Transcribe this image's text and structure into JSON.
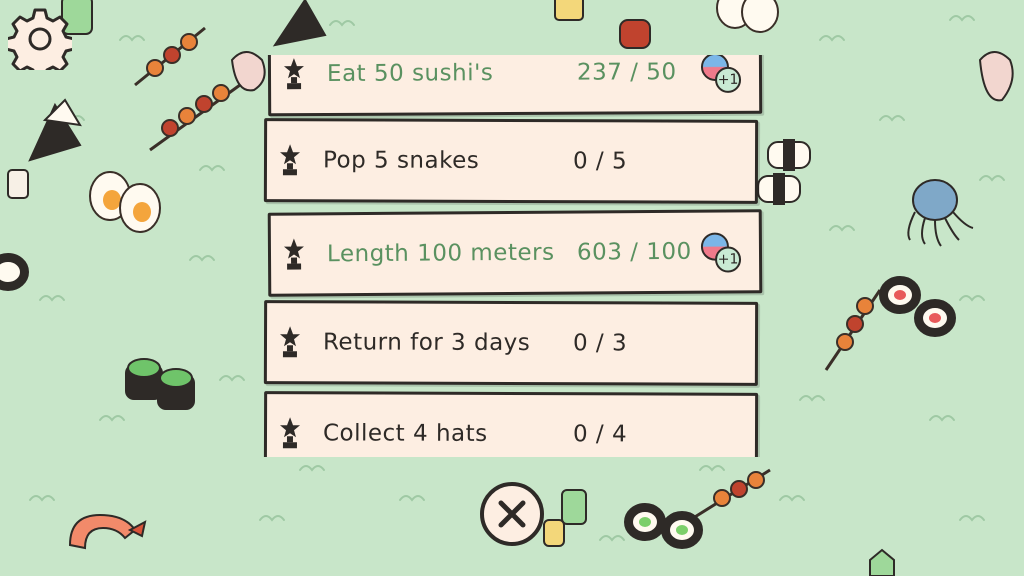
{
  "quests": [
    {
      "label": "Eat 50 sushi's",
      "progress": "237 / 50",
      "completed": true,
      "reward": "+1"
    },
    {
      "label": "Pop 5 snakes",
      "progress": "0 / 5",
      "completed": false
    },
    {
      "label": "Length 100 meters",
      "progress": "603 / 100",
      "completed": true,
      "reward": "+1"
    },
    {
      "label": "Return for 3 days",
      "progress": "0 / 3",
      "completed": false
    },
    {
      "label": "Collect 4 hats",
      "progress": "0 / 4",
      "completed": false
    }
  ],
  "icons": {
    "settings": "gear-icon",
    "close": "close-icon",
    "quest": "trophy-icon",
    "reward": "gem-reward-icon"
  },
  "colors": {
    "background": "#c8e6c9",
    "card": "#fdeee2",
    "outline": "#2e2a27",
    "completed_text": "#5a9160"
  }
}
